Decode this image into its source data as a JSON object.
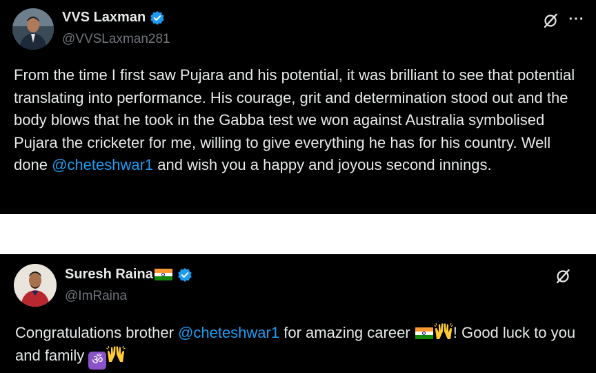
{
  "tweets": [
    {
      "display_name": "VVS Laxman",
      "handle": "@VVSLaxman281",
      "text_parts": {
        "p1": "From the time I first saw Pujara and his potential, it was brilliant to see that potential translating into performance. His courage, grit and determination stood out and the body blows that he took in the Gabba test we won against Australia symbolised Pujara the cricketer for me, willing to give everything he has for his country. Well done ",
        "mention": "@cheteshwar1",
        "p2": " and wish you a happy and joyous second innings."
      },
      "more_label": "···"
    },
    {
      "display_name": "Suresh Raina",
      "name_emoji": "indian-flag",
      "handle": "@ImRaina",
      "text_parts": {
        "p1": "Congratulations brother ",
        "mention": "@cheteshwar1",
        "p2": " for amazing career ",
        "p3": "! Good luck to you and family "
      },
      "emojis": [
        "indian-flag",
        "raising-hands",
        "om-symbol",
        "raising-hands"
      ]
    }
  ],
  "colors": {
    "background": "#000000",
    "text": "#e7e9ea",
    "handle": "#71767b",
    "link": "#1d9bf0",
    "verified": "#1d9bf0",
    "separator": "#ffffff"
  },
  "icons": [
    "grok-icon",
    "more-icon",
    "verified-badge-icon"
  ]
}
